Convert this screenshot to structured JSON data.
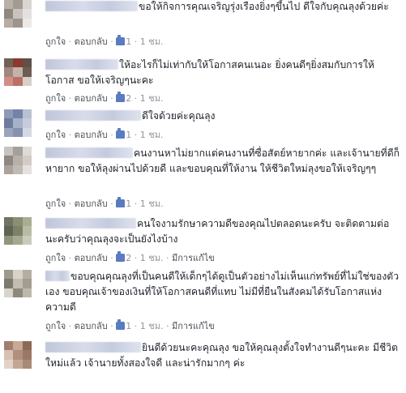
{
  "common": {
    "like": "ถูกใจ",
    "reply": "ตอบกลับ",
    "dot": "·",
    "edited": "มีการแก้ไข"
  },
  "comments": [
    {
      "text": "ขอให้กิจการคุณเจริญรุ่งเรืองยิ่งๆขึ้นไป ดีใจกับคุณลุงด้วยค่ะ",
      "likes": "1",
      "time": "1 ชม.",
      "edited": false,
      "avatar": [
        "#b8b1a9",
        "#a39a92",
        "#d9d6d2",
        "#8f8780",
        "#c9c3be",
        "#e3e1df",
        "#b5aca6",
        "#9d948e",
        "#ece9e6"
      ]
    },
    {
      "text": "ให้อะไรก็ไม่เท่ากับให้โอกาสคนเนอะ ยิ่งคนดีๆยิ่งสมกับการให้โอกาส ขอให้เจริญๆนะคะ",
      "likes": "2",
      "time": "1 ชม.",
      "edited": false,
      "avatar": [
        "#6f6259",
        "#8b3a2f",
        "#5f5048",
        "#a0897c",
        "#c4b3a8",
        "#6d5d55",
        "#cf8f86",
        "#bb6f67",
        "#d9cfc9"
      ]
    },
    {
      "text": "ดีใจด้วยค่ะคุณลุง",
      "likes": "1",
      "time": "1 ชม.",
      "edited": false,
      "avatar": [
        "#8f9bb6",
        "#7383a6",
        "#b8c0d2",
        "#6d7c9c",
        "#a7b1c8",
        "#c6ccdb",
        "#99a4bd",
        "#8593b0",
        "#d3d8e3"
      ]
    },
    {
      "text": "คนงานหาไม่ยากแต่คนงานที่ซื่อสัตย์หายากค่ะ และเจ้านายที่ดีก็หายาก ขอให้ลุงผ่านไปด้วยดี และขอบคุณที่ให้งาน ให้ชีวิตใหม่ลุงขอให้เจริญๆๆ",
      "likes": "1",
      "time": "1 ชม.",
      "edited": false,
      "avatar": [
        "#c8c3bf",
        "#a59f9a",
        "#dedad6",
        "#8e8782",
        "#b7b0ab",
        "#d1ccc8",
        "#a9a29d",
        "#c0bab5",
        "#e4e1de"
      ]
    },
    {
      "text": "คนใจงามรักษาความดีของคุณไปตลอดนะครับ จะติดตามต่อนะครับว่าคุณลุงจะเป็นยังไงบ้าง",
      "likes": "2",
      "time": "1 ชม.",
      "edited": true,
      "avatar": [
        "#6f7560",
        "#8a8f72",
        "#a9ad93",
        "#5f6552",
        "#7c8267",
        "#b8bca5",
        "#90957c",
        "#a4a98f",
        "#c9ccba"
      ]
    },
    {
      "text": "ขอบคุณคุณลุงที่เป็นคนดีให้เด็กๆได้ดูเป็นตัวอย่างไม่เห็นแก่ทรัพย์ที่ไม่ใช่ของตัวเอง ขอบคุณเจ้าของเงินที่ให้โอกาสคนดีที่แทบ ไม่มีที่ยืนในสังคมได้รับโอกาสแห่งความดี",
      "likes": "1",
      "time": "1 ชม.",
      "edited": true,
      "avatar": [
        "#9e9a8e",
        "#d7d3c9",
        "#b3ae9f",
        "#7e7a6e",
        "#c2bdb0",
        "#a29d90",
        "#d9d5cc",
        "#8d897c",
        "#bdb8ab"
      ]
    },
    {
      "text": "ยินดีด้วยนะคะคุณลุง ขอให้คุณลุงตั้งใจทำงานดีๆนะคะ มีชีวิตใหม่แล้ว เจ้านายทั้งสองใจดี และน่ารักมากๆ ค่ะ",
      "likes": "",
      "time": "",
      "edited": false,
      "avatar": [
        "#a17f6c",
        "#c7a996",
        "#8c6a58",
        "#d6c1b3",
        "#b18f7c",
        "#9a7866",
        "#e1d3c9",
        "#c3a794",
        "#a98a77"
      ]
    }
  ]
}
